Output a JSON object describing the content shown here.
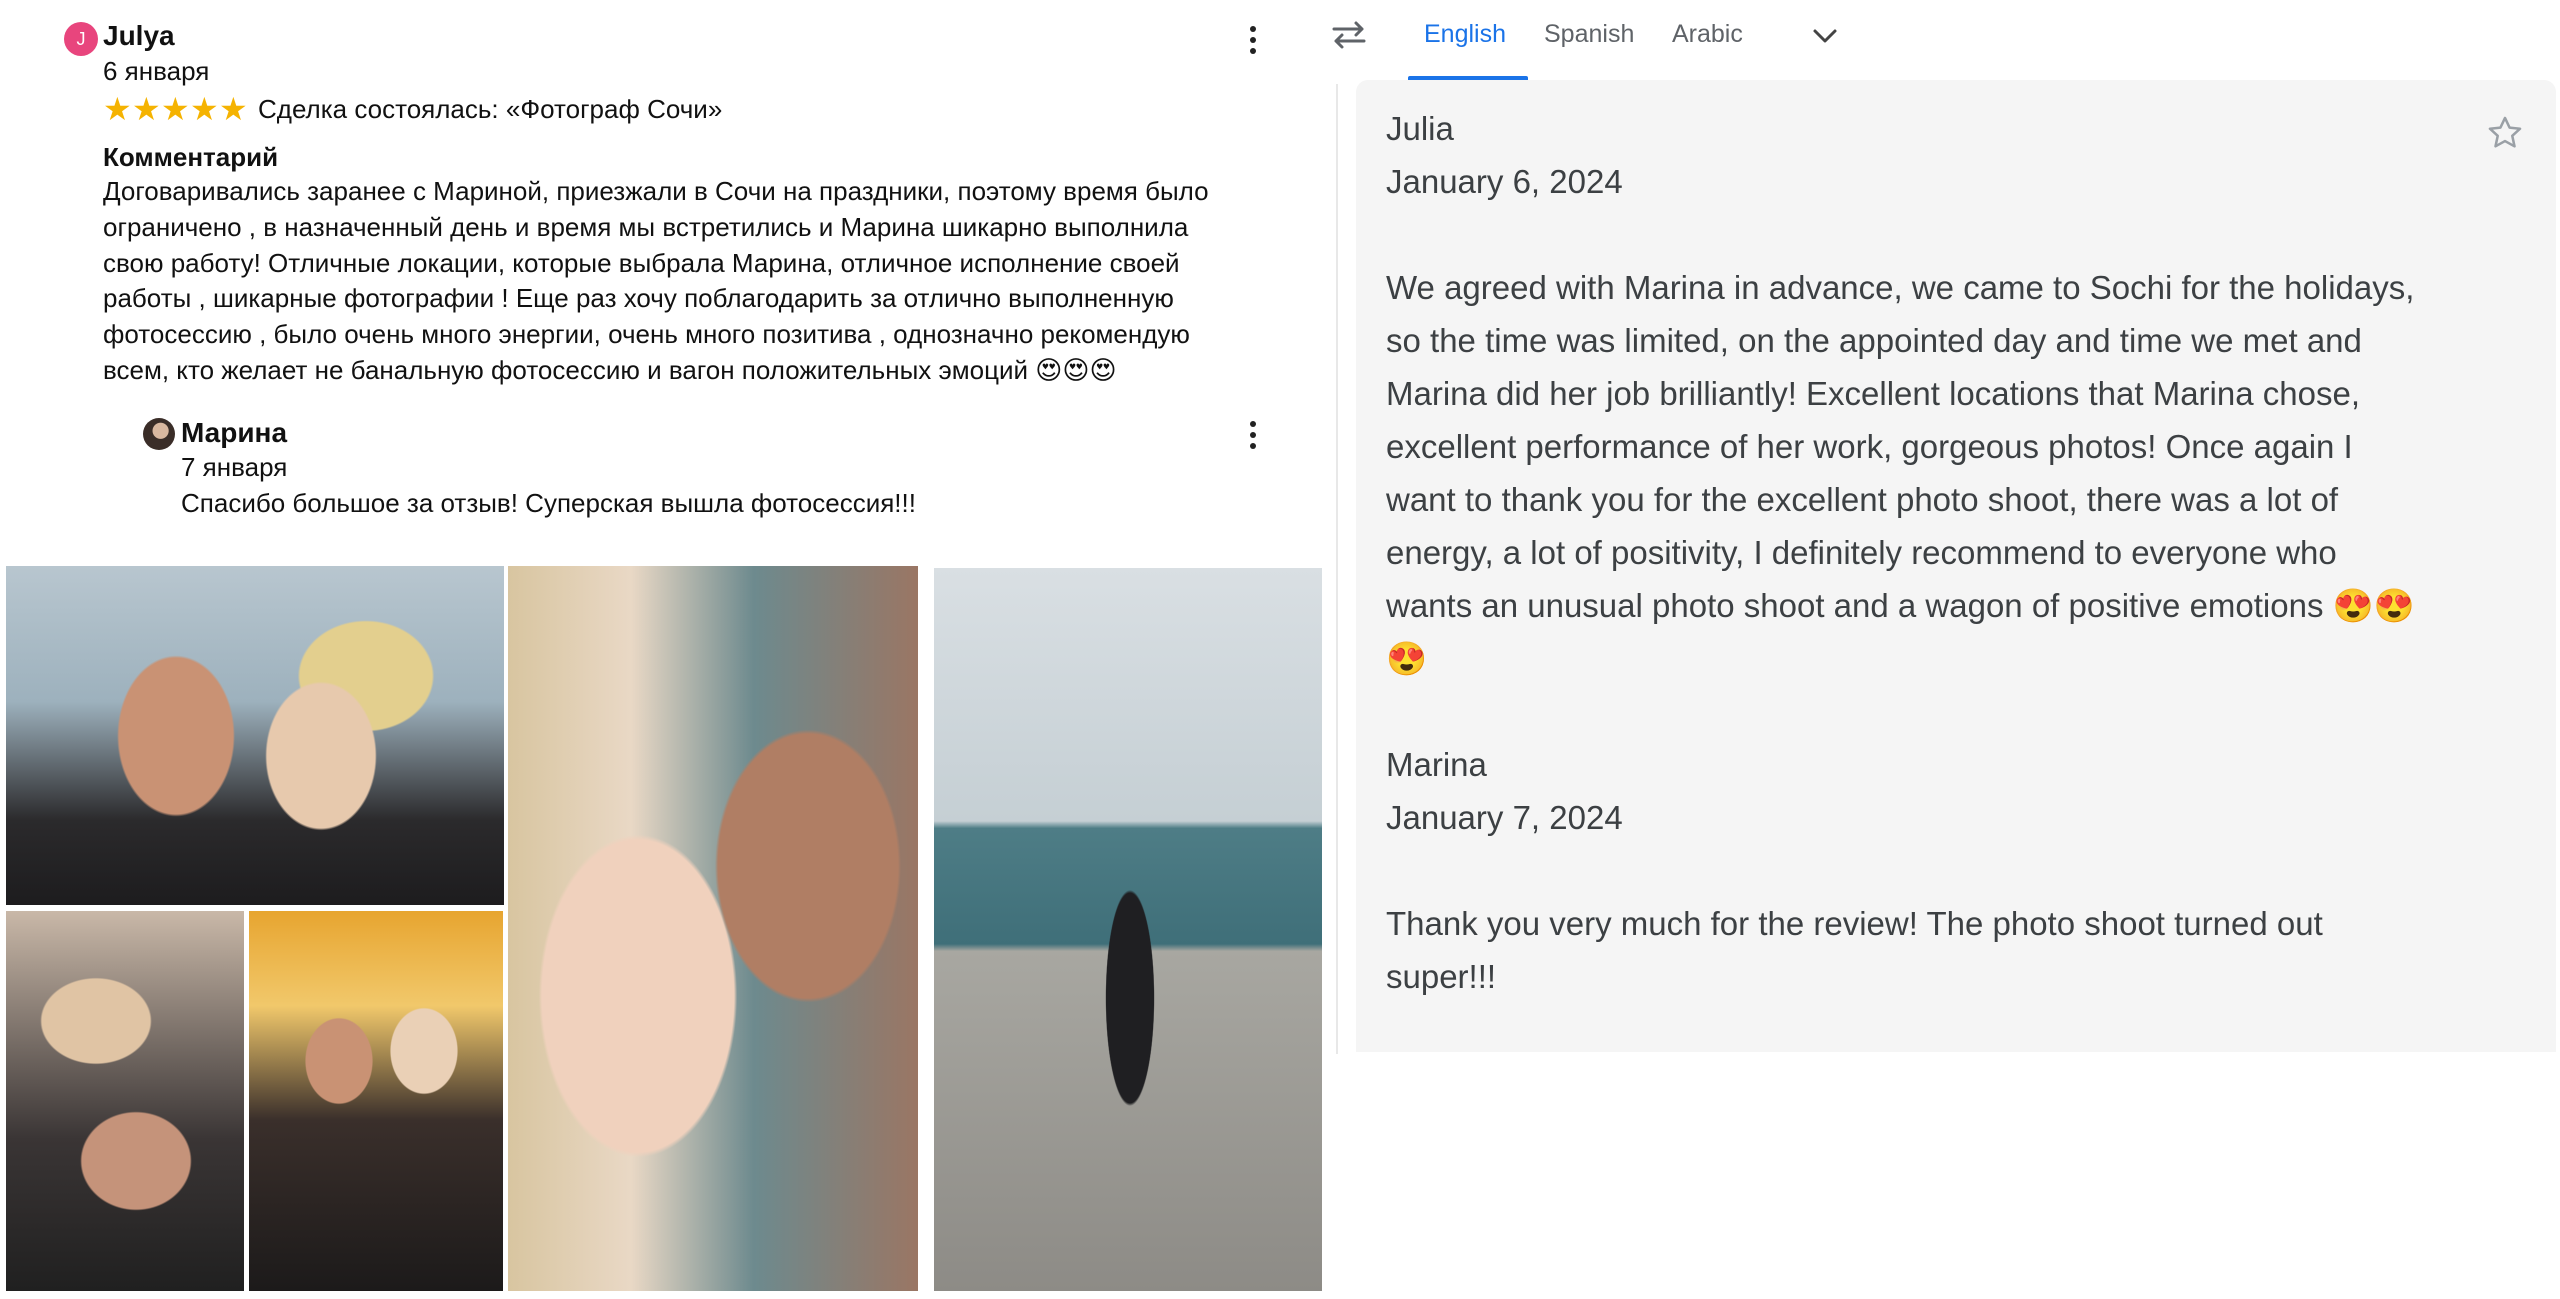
{
  "review": {
    "avatar_letter": "J",
    "author": "Julya",
    "date": "6 января",
    "stars": 5,
    "deal": "Сделка состоялась: «Фотограф Сочи»",
    "comment_heading": "Комментарий",
    "comment_lines": [
      "Договаривались заранее с Мариной, приезжали в Сочи на праздники, поэтому время было",
      "ограничено , в назначенный день и время мы встретились и Марина шикарно выполнила",
      "свою работу! Отличные локации, которые выбрала Марина, отличное исполнение своей",
      "работы , шикарные фотографии ! Еще раз хочу поблагодарить за отлично выполненную",
      "фотосессию , было очень много энергии, очень много позитива , однозначно рекомендую",
      "всем, кто желает не банальную фотосессию и вагон положительных эмоций 😍😍😍"
    ]
  },
  "reply": {
    "author": "Марина",
    "date": "7 января",
    "text": "Спасибо большое за отзыв! Суперская вышла фотосессия!!!"
  },
  "photos": [
    "couple-forehead-touch",
    "couple-close-kiss",
    "couple-on-pier",
    "couple-kiss-leather-jacket",
    "couple-kiss-carousel"
  ],
  "translate": {
    "tabs": [
      "English",
      "Spanish",
      "Arabic"
    ],
    "active_tab": "English",
    "accent_color": "#1a73e8",
    "icons": [
      "swap-languages-icon",
      "chevron-down-icon",
      "star-outline-icon"
    ],
    "review_author": "Julia",
    "review_date": "January 6, 2024",
    "review_lines": [
      "We agreed with Marina in advance, we came to Sochi for the holidays,",
      "so the time was limited, on the appointed day and time we met and",
      "Marina did her job brilliantly! Excellent locations that Marina chose,",
      "excellent performance of her work, gorgeous photos! Once again I",
      "want to thank you for the excellent photo shoot, there was a lot of",
      "energy, a lot of positivity, I definitely recommend to everyone who",
      "wants an unusual photo shoot and a wagon of positive emotions 😍😍",
      "😍"
    ],
    "reply_author": "Marina",
    "reply_date": "January 7, 2024",
    "reply_lines": [
      "Thank you very much for the review! The photo shoot turned out",
      "super!!!"
    ]
  }
}
